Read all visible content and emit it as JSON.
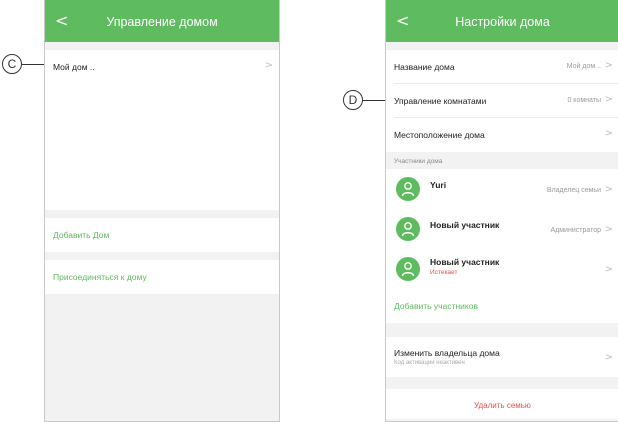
{
  "left_screen": {
    "header": {
      "back": "<",
      "title": "Управление домом"
    },
    "home_row": {
      "label": "Мой дом ..",
      "chevron": ">"
    },
    "add_home": "Добавить Дом",
    "join_home": "Присоединяться к дому"
  },
  "right_screen": {
    "header": {
      "back": "<",
      "title": "Настройки дома"
    },
    "rows": [
      {
        "label": "Название дома",
        "value": "Мой дом ..",
        "chevron": ">"
      },
      {
        "label": "Управление комнатами",
        "value": "0 комнаты",
        "chevron": ">"
      },
      {
        "label": "Местоположение дома",
        "value": "",
        "chevron": ">"
      }
    ],
    "members_header": "Участники дома",
    "members": [
      {
        "name": "Yuri",
        "role": "Владелец семьи",
        "status": ""
      },
      {
        "name": "Новый участник",
        "role": "Администратор",
        "status": ""
      },
      {
        "name": "Новый участник",
        "role": "",
        "status": "Истекает"
      }
    ],
    "add_members": "Добавить участников",
    "change_owner": {
      "label": "Изменить владельца дома",
      "sub": "Код активации неактивен"
    },
    "delete_family": "Удалить семью"
  },
  "callouts": {
    "c": "C",
    "d": "D"
  },
  "colors": {
    "accent": "#5fbb5f",
    "danger": "#e15050"
  }
}
